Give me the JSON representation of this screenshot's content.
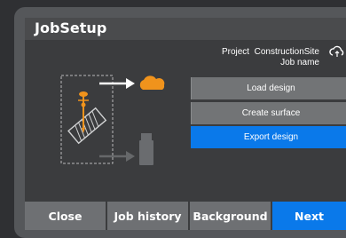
{
  "window": {
    "title": "JobSetup"
  },
  "project": {
    "label": "Project",
    "name": "ConstructionSite",
    "job_name_label": "Job name"
  },
  "icons": {
    "sync": "cloud-sync-icon",
    "cloud": "cloud-icon",
    "usb": "usb-drive-icon",
    "machine": "excavator-icon"
  },
  "colors": {
    "accent": "#0a79ea",
    "cloud": "#f0931c",
    "machine": "#f0931c",
    "button_gray": "#727476"
  },
  "actions": [
    {
      "label": "Load design"
    },
    {
      "label": "Create surface"
    },
    {
      "label": "Export design"
    }
  ],
  "footer": {
    "close": "Close",
    "job_history": "Job history",
    "background": "Background",
    "next": "Next"
  }
}
